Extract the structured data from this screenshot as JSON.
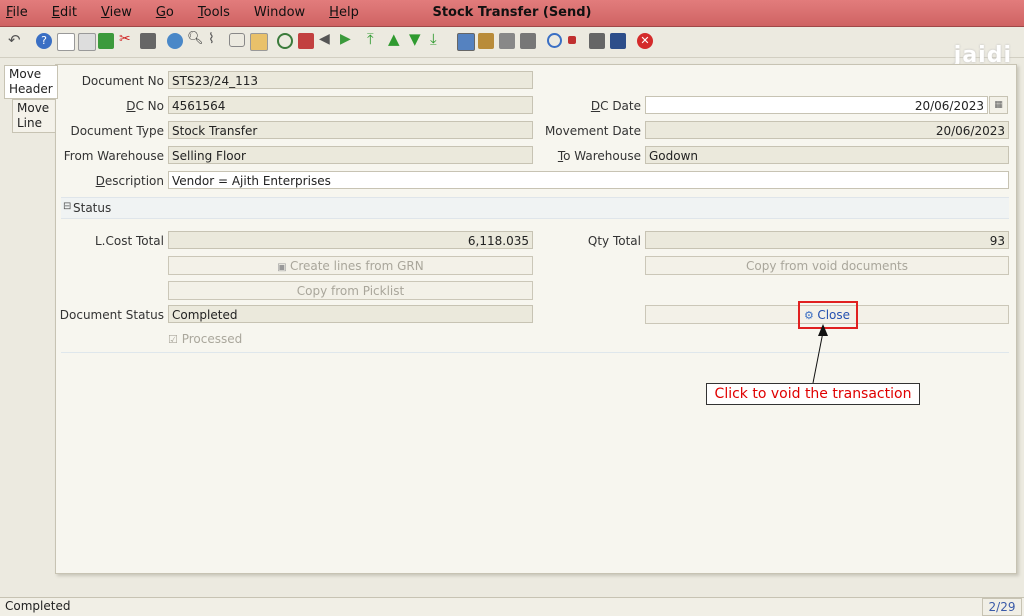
{
  "window": {
    "title": "Stock Transfer (Send)",
    "brand": "jaidi"
  },
  "menu": [
    {
      "key": "F",
      "rest": "ile"
    },
    {
      "key": "E",
      "rest": "dit"
    },
    {
      "key": "V",
      "rest": "iew"
    },
    {
      "key": "G",
      "rest": "o"
    },
    {
      "key": "T",
      "rest": "ools"
    },
    {
      "key": "",
      "rest": "Window"
    },
    {
      "key": "H",
      "rest": "elp"
    }
  ],
  "tabs": {
    "header": "Move\nHeader",
    "line": "Move\nLine"
  },
  "form": {
    "document_no": {
      "label": "Document No",
      "value": "STS23/24_113"
    },
    "dc_no": {
      "label_key": "D",
      "label_rest": "C No",
      "value": "4561564"
    },
    "dc_date": {
      "label_key": "D",
      "label_rest": "C Date",
      "value": "20/06/2023"
    },
    "document_type": {
      "label": "Document Type",
      "value": "Stock Transfer"
    },
    "movement_date": {
      "label": "Movement Date",
      "value": "20/06/2023"
    },
    "from_warehouse": {
      "label": "From Warehouse",
      "value": "Selling Floor"
    },
    "to_warehouse": {
      "label_key": "T",
      "label_rest": "o Warehouse",
      "value": "Godown"
    },
    "description": {
      "label_key": "D",
      "label_rest": "escription",
      "value": "Vendor = Ajith Enterprises"
    }
  },
  "status_section": {
    "title": "Status",
    "lcost_total": {
      "label": "L.Cost Total",
      "value": "6,118.035"
    },
    "qty_total": {
      "label": "Qty Total",
      "value": "93"
    },
    "btn_create_lines": "Create lines from GRN",
    "btn_copy_void": "Copy from void documents",
    "btn_copy_picklist": "Copy from Picklist",
    "document_status": {
      "label": "Document Status",
      "value": "Completed"
    },
    "btn_close": "Close",
    "processed": "Processed"
  },
  "callout": "Click to void the transaction",
  "statusbar": {
    "text": "Completed",
    "page": "2/29"
  },
  "colors": {
    "title_bar": "#d96b6b",
    "callout_text": "#e00000",
    "field_bg": "#ebe9dc"
  }
}
